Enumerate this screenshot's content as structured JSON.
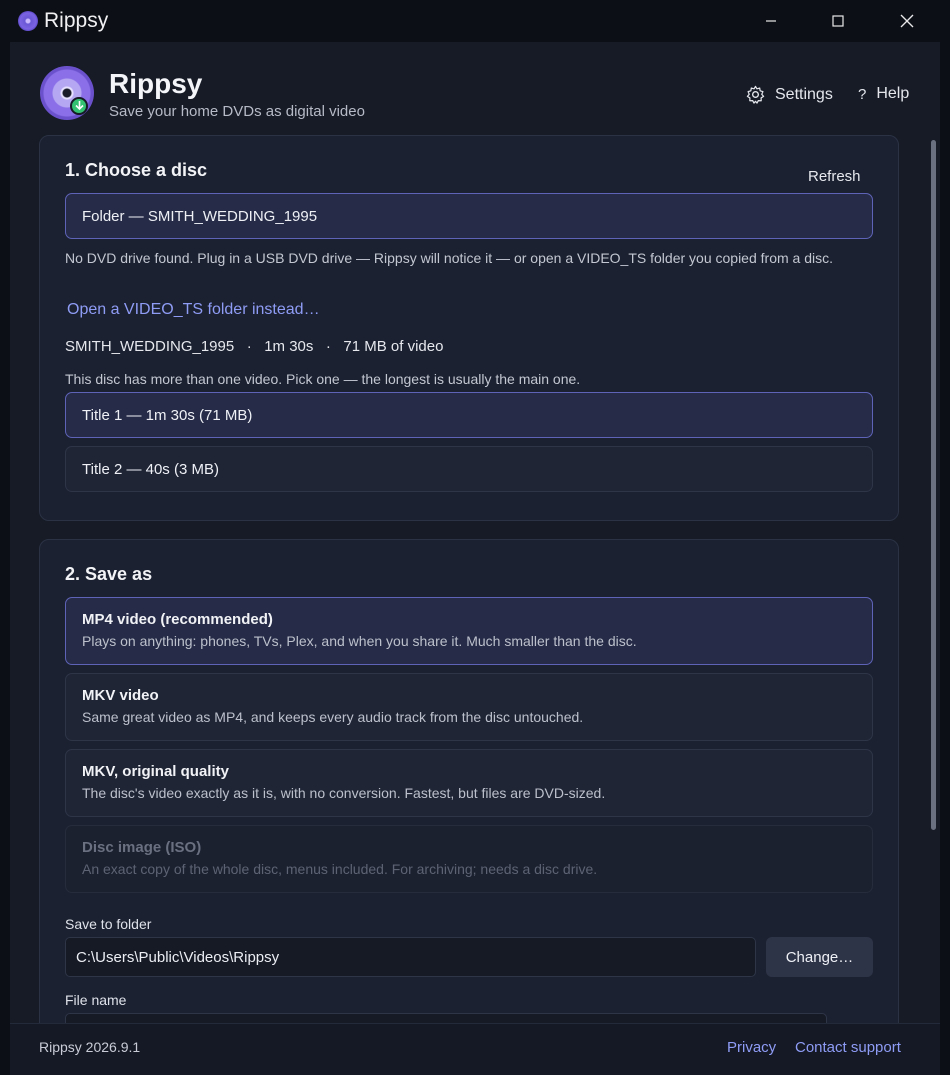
{
  "window": {
    "title": "Rippsy",
    "minimize_glyph": "—",
    "maximize_glyph": "☐",
    "close_glyph": "✕"
  },
  "header": {
    "title": "Rippsy",
    "subtitle": "Save your home DVDs as digital video",
    "settings_label": "Settings",
    "settings_icon": "gear-icon",
    "help_label": "Help",
    "help_glyph": "?"
  },
  "choose_disc": {
    "heading": "1.  Choose a disc",
    "refresh_label": "Refresh",
    "source_value": "Folder  —  SMITH_WEDDING_1995",
    "no_drive_note": "No DVD drive found. Plug in a USB DVD drive — Rippsy will notice it — or open a VIDEO_TS folder you copied from a disc.",
    "open_folder_link": "Open a VIDEO_TS folder instead…",
    "disc_info": "SMITH_WEDDING_1995   ·   1m 30s   ·   71 MB of video",
    "multi_title_note": "This disc has more than one video. Pick one — the longest is usually the main one.",
    "titles": [
      {
        "label": "Title 1 — 1m 30s (71 MB)",
        "selected": true
      },
      {
        "label": "Title 2 — 40s (3 MB)",
        "selected": false
      }
    ]
  },
  "save_as": {
    "heading": "2.  Save as",
    "formats": [
      {
        "title": "MP4 video (recommended)",
        "desc": "Plays on anything: phones, TVs, Plex, and when you share it. Much smaller than the disc.",
        "state": "selected"
      },
      {
        "title": "MKV video",
        "desc": "Same great video as MP4, and keeps every audio track from the disc untouched.",
        "state": "normal"
      },
      {
        "title": "MKV, original quality",
        "desc": "The disc's video exactly as it is, with no conversion. Fastest, but files are DVD-sized.",
        "state": "normal"
      },
      {
        "title": "Disc image (ISO)",
        "desc": "An exact copy of the whole disc, menus included. For archiving; needs a disc drive.",
        "state": "disabled"
      }
    ],
    "folder_label": "Save to folder",
    "folder_value": "C:\\Users\\Public\\Videos\\Rippsy",
    "change_button": "Change…",
    "filename_label": "File name"
  },
  "footer": {
    "version": "Rippsy 2026.9.1",
    "privacy_link": "Privacy",
    "support_link": "Contact support"
  },
  "colors": {
    "accent": "#8f9cf5",
    "selected_border": "#5f63b8",
    "badge_green": "#33c172"
  }
}
